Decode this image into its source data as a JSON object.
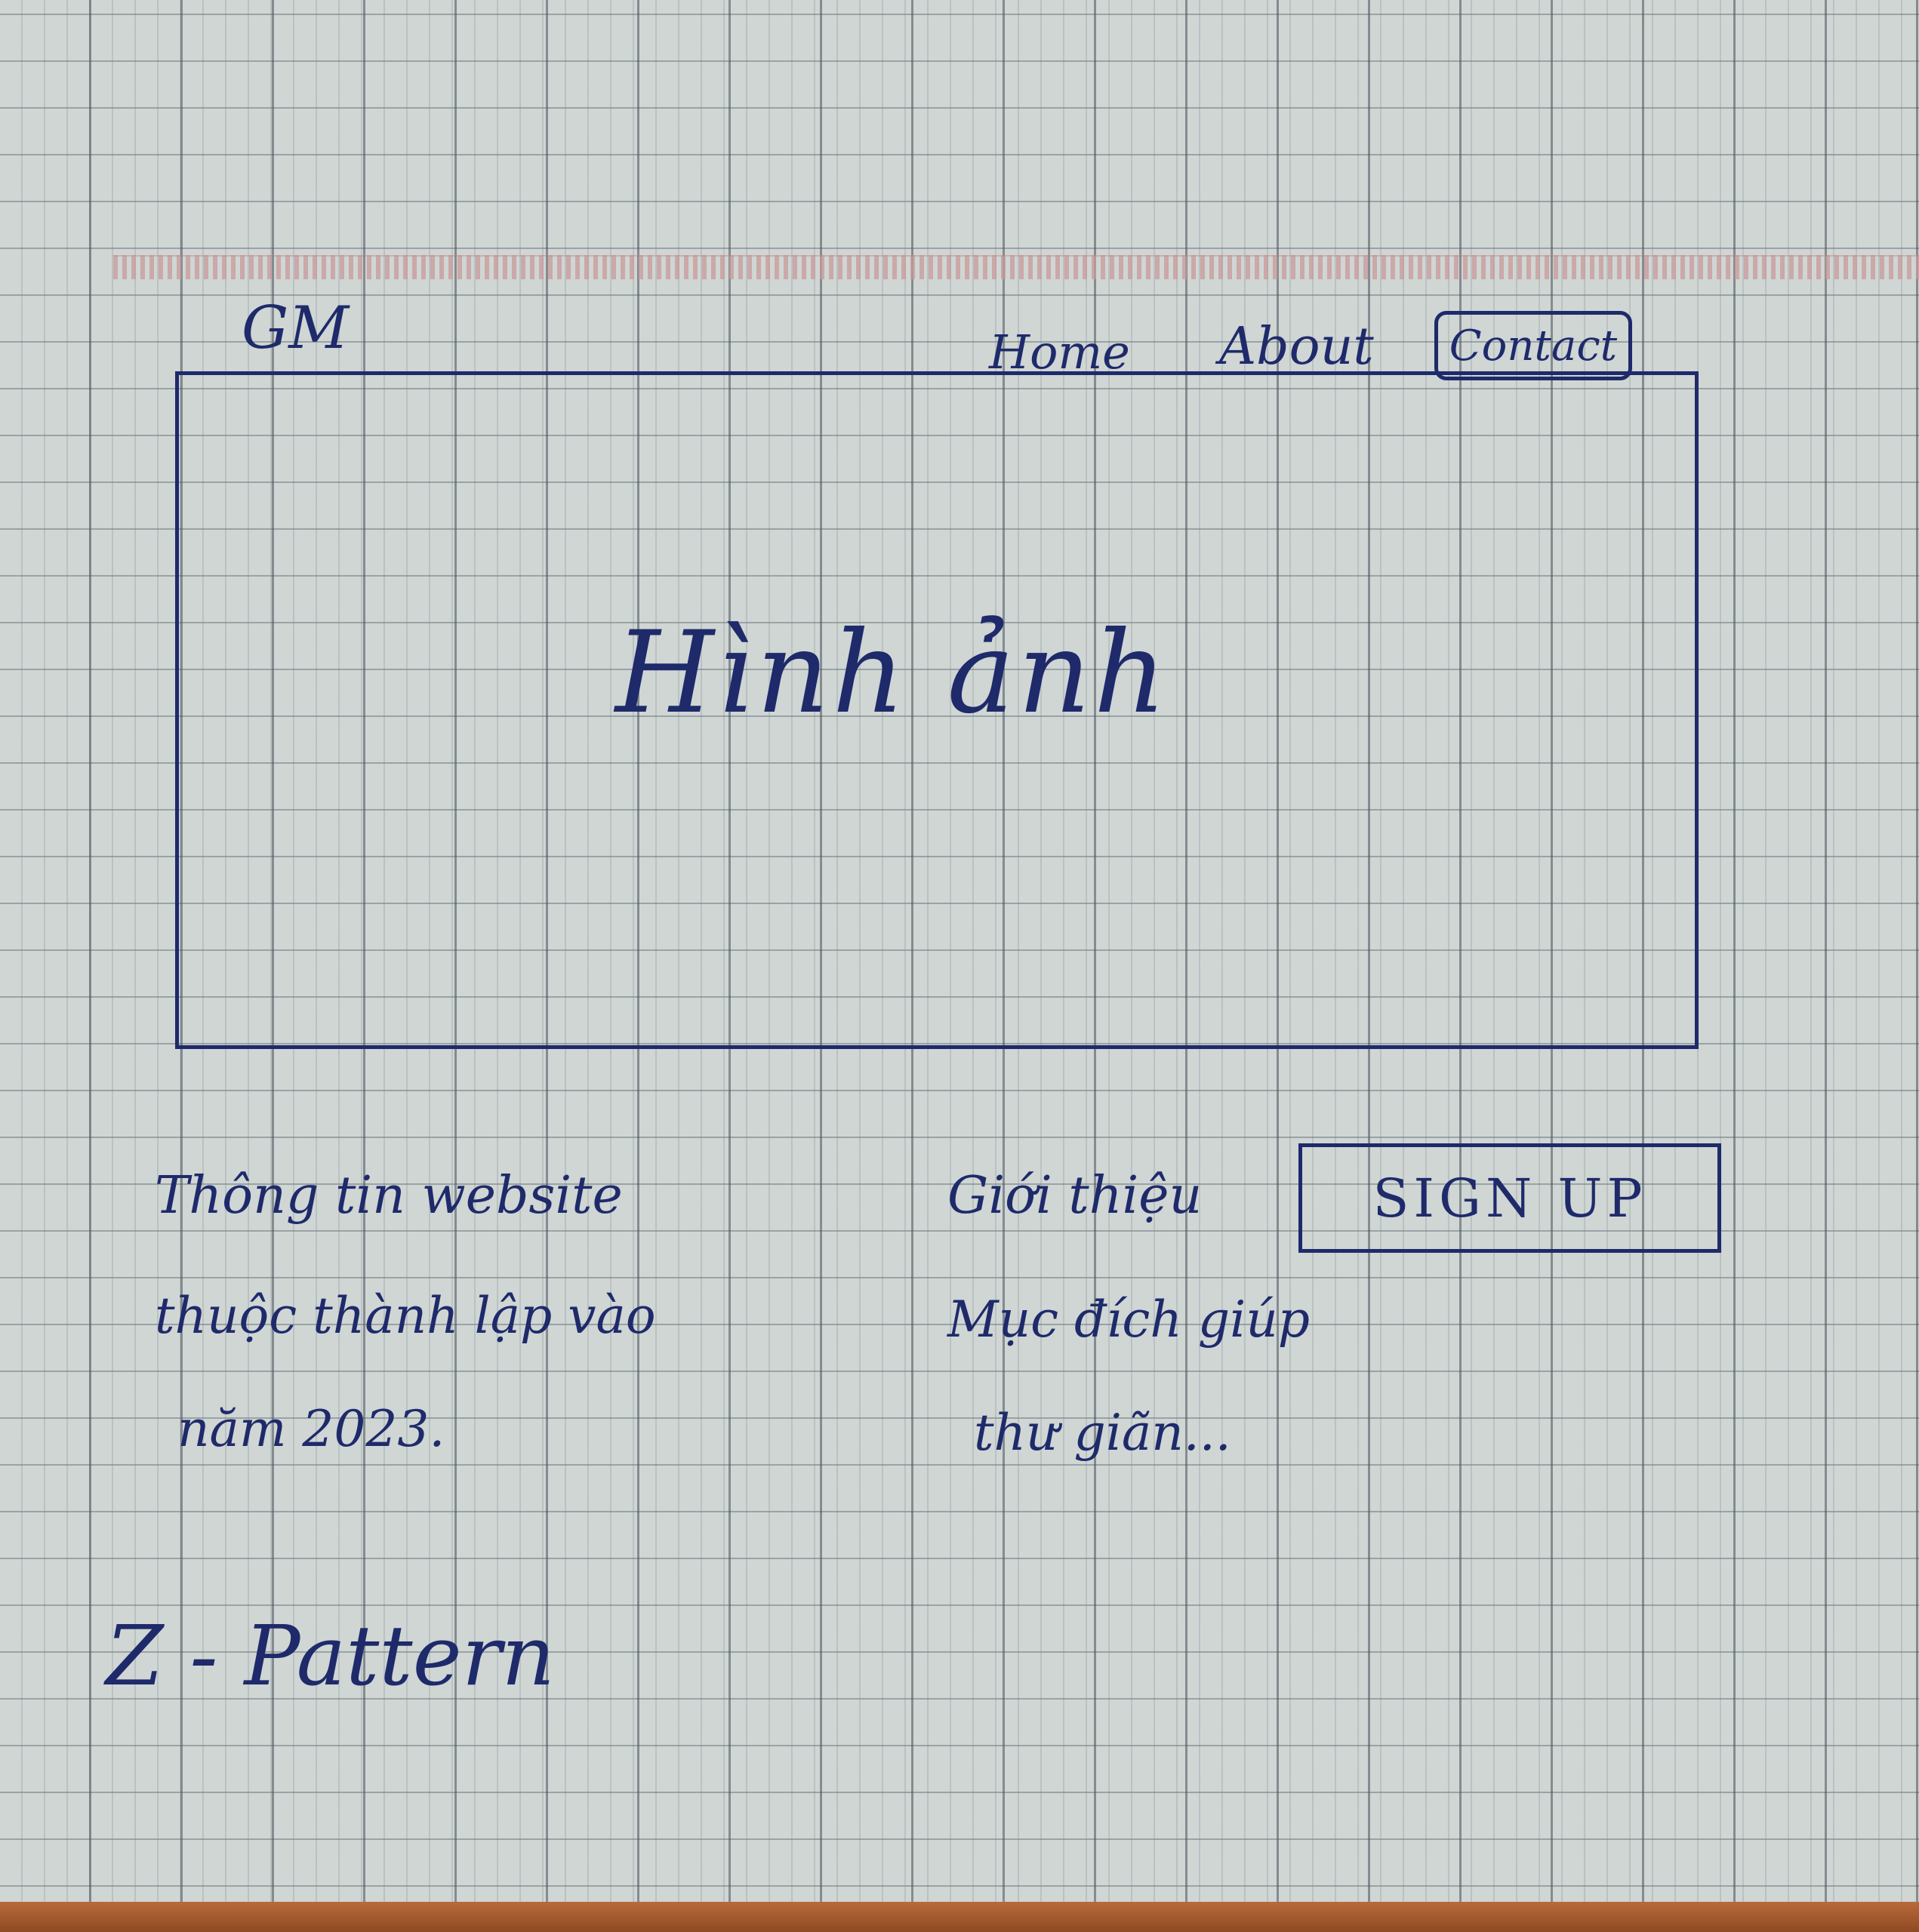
{
  "header": {
    "logo_text": "GM",
    "nav": {
      "home": "Home",
      "about": "About",
      "contact": "Contact"
    }
  },
  "hero": {
    "label": "Hình ảnh"
  },
  "info": {
    "title": "Thông tin website",
    "line1": "thuộc thành lập vào",
    "line2": "năm 2023."
  },
  "about": {
    "title": "Giới thiệu",
    "line1": "Mục đích giúp",
    "line2": "thư giãn..."
  },
  "cta": {
    "signup_label": "SIGN UP"
  },
  "note": {
    "text": "Z - Pattern"
  }
}
